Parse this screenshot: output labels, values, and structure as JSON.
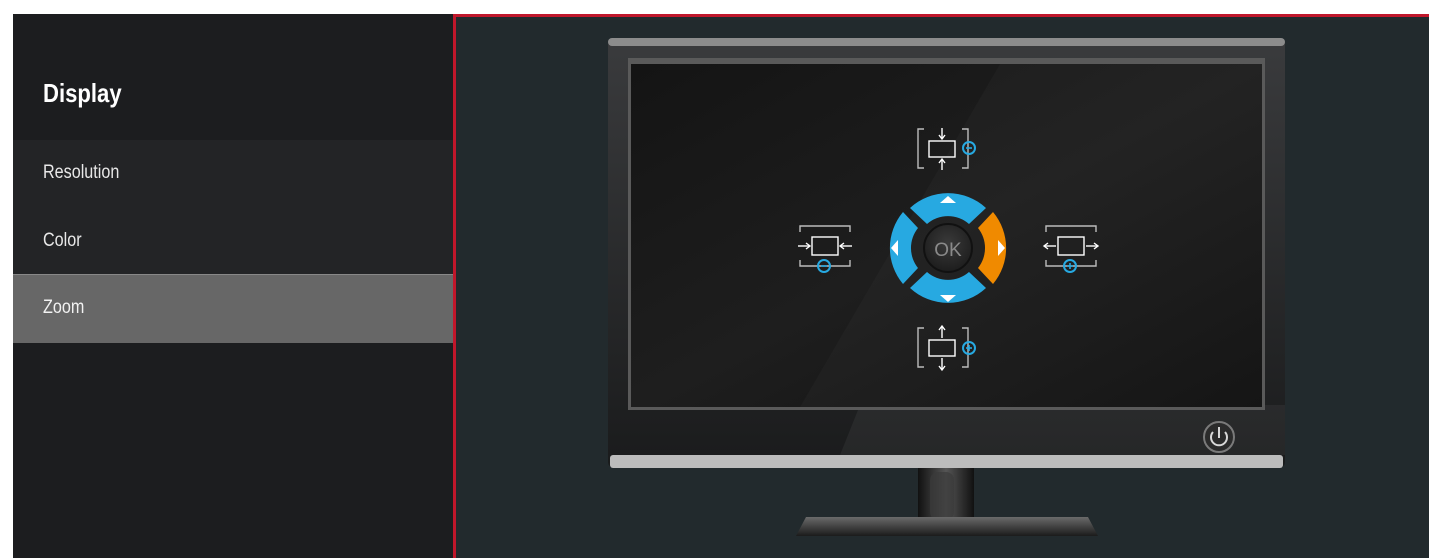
{
  "sidebar": {
    "title": "Display",
    "items": [
      {
        "label": "Resolution",
        "selected": false
      },
      {
        "label": "Color",
        "selected": false
      },
      {
        "label": "Zoom",
        "selected": true
      }
    ]
  },
  "preview": {
    "ok_label": "OK",
    "colors": {
      "accent_border": "#c0172b",
      "dpad_blue": "#27a9e1",
      "dpad_orange": "#f08a00",
      "selected_item_bg": "#676767"
    }
  }
}
